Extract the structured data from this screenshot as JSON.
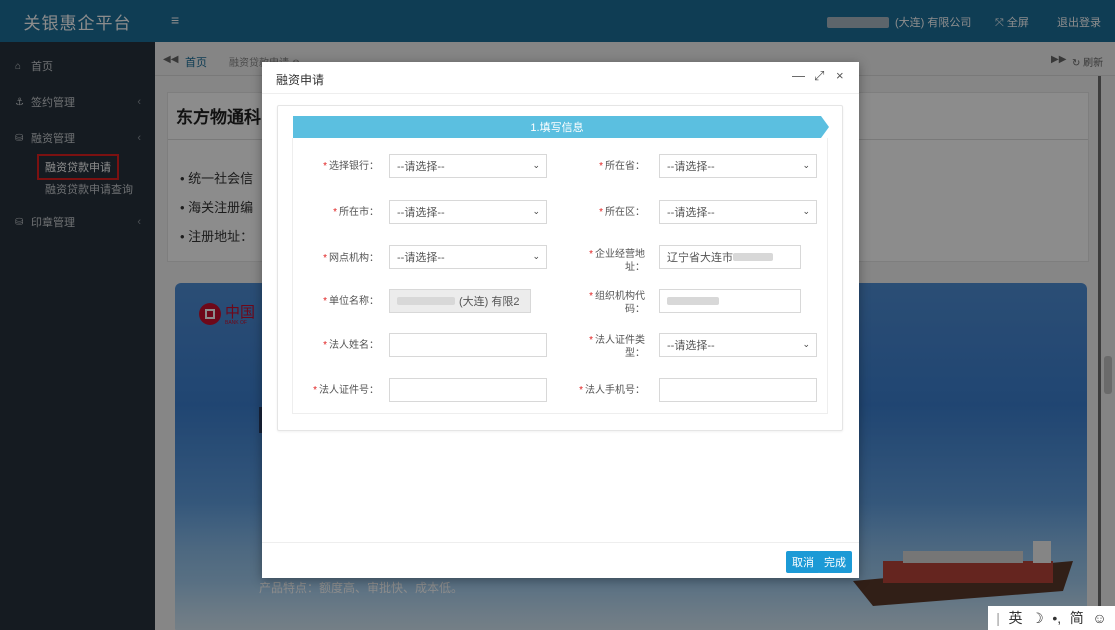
{
  "app": {
    "title": "关银惠企平台",
    "company_suffix": "(大连) 有限公司",
    "fullscreen_label": "全屏",
    "logout_label": "退出登录"
  },
  "sidebar": {
    "items": [
      {
        "label": "首页",
        "icon": "home-icon"
      },
      {
        "label": "签约管理",
        "icon": "contract-icon"
      },
      {
        "label": "融资管理",
        "icon": "finance-icon"
      },
      {
        "label": "印章管理",
        "icon": "seal-icon"
      }
    ],
    "sub_items": [
      {
        "label": "融资贷款申请",
        "active": true
      },
      {
        "label": "融资贷款申请查询",
        "active": false
      }
    ]
  },
  "tabs": {
    "home": "首页",
    "loan_apply": "融资贷款申请 ⊗",
    "refresh": "刷新"
  },
  "main": {
    "panel_title": "东方物通科",
    "lines": [
      "统一社会信",
      "海关注册编",
      "注册地址："
    ],
    "banner_features": "产品特点：额度高、审批快、成本低。"
  },
  "modal": {
    "title": "融资申请",
    "step": "1.填写信息",
    "fields": {
      "bank_label": "选择银行：",
      "bank_value": "--请选择--",
      "province_label": "所在省：",
      "province_value": "--请选择--",
      "city_label": "所在市：",
      "city_value": "--请选择--",
      "district_label": "所在区：",
      "district_value": "--请选择--",
      "branch_label": "网点机构：",
      "branch_value": "--请选择--",
      "address_label": "企业经营地址：",
      "address_value": "辽宁省大连市",
      "unit_name_label": "单位名称：",
      "unit_name_value": "(大连) 有限2",
      "org_code_label": "组织机构代码：",
      "legal_name_label": "法人姓名：",
      "legal_name_value": "",
      "legal_id_type_label": "法人证件类型：",
      "legal_id_type_value": "--请选择--",
      "legal_id_no_label": "法人证件号：",
      "legal_id_no_value": "",
      "legal_phone_label": "法人手机号：",
      "legal_phone_value": ""
    },
    "cancel_label": "取消",
    "finish_label": "完成"
  },
  "ime": {
    "lang": "英",
    "mode": "简"
  }
}
